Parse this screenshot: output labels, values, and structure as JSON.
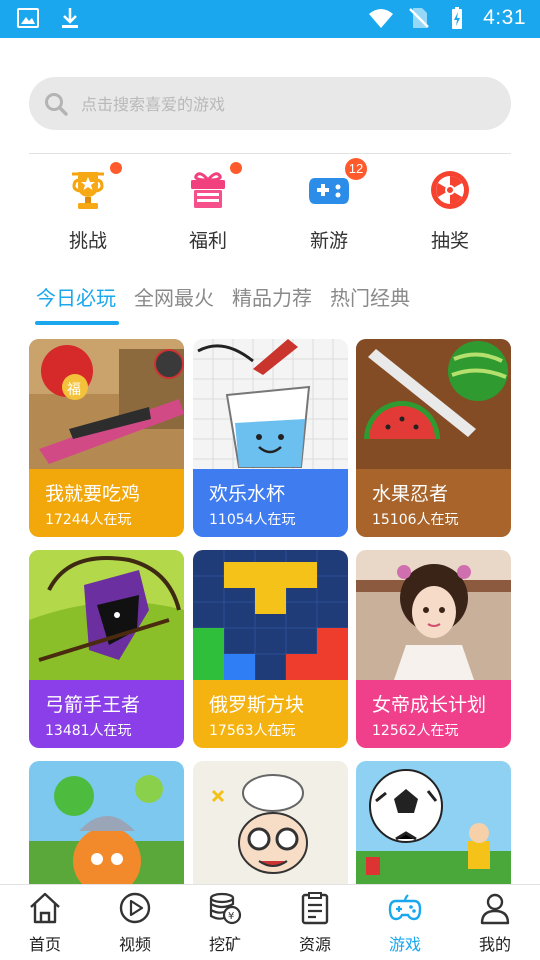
{
  "status_bar": {
    "time": "4:31",
    "left_icons": [
      "image-icon",
      "download-icon"
    ],
    "right_icons": [
      "wifi-icon",
      "no-sim-icon",
      "battery-charging-icon"
    ],
    "bg_color": "#1aa7ee"
  },
  "search": {
    "placeholder": "点击搜索喜爱的游戏",
    "icon": "search-icon"
  },
  "quick_entries": [
    {
      "label": "挑战",
      "icon": "trophy-icon",
      "indicator": "dot"
    },
    {
      "label": "福利",
      "icon": "gift-icon",
      "indicator": "dot"
    },
    {
      "label": "新游",
      "icon": "gamepad-icon",
      "badge": "12"
    },
    {
      "label": "抽奖",
      "icon": "lottery-wheel-icon"
    }
  ],
  "tabs": [
    {
      "label": "今日必玩",
      "active": true
    },
    {
      "label": "全网最火",
      "active": false
    },
    {
      "label": "精品力荐",
      "active": false
    },
    {
      "label": "热门经典",
      "active": false
    }
  ],
  "games": [
    {
      "title": "我就要吃鸡",
      "players": "17244人在玩",
      "color": "#f2a70b"
    },
    {
      "title": "欢乐水杯",
      "players": "11054人在玩",
      "color": "#3f7cf0"
    },
    {
      "title": "水果忍者",
      "players": "15106人在玩",
      "color": "#a8642b"
    },
    {
      "title": "弓箭手王者",
      "players": "13481人在玩",
      "color": "#8a3fe8"
    },
    {
      "title": "俄罗斯方块",
      "players": "17563人在玩",
      "color": "#f5b312"
    },
    {
      "title": "女帝成长计划",
      "players": "12562人在玩",
      "color": "#f0408c"
    }
  ],
  "bottom_nav": [
    {
      "label": "首页",
      "icon": "home-icon",
      "active": false
    },
    {
      "label": "视频",
      "icon": "play-circle-icon",
      "active": false
    },
    {
      "label": "挖矿",
      "icon": "coin-stack-icon",
      "active": false
    },
    {
      "label": "资源",
      "icon": "clipboard-icon",
      "active": false
    },
    {
      "label": "游戏",
      "icon": "game-controller-icon",
      "active": true
    },
    {
      "label": "我的",
      "icon": "person-icon",
      "active": false
    }
  ],
  "accent_color": "#1aa7ee",
  "indicator_color": "#ff5a2c"
}
